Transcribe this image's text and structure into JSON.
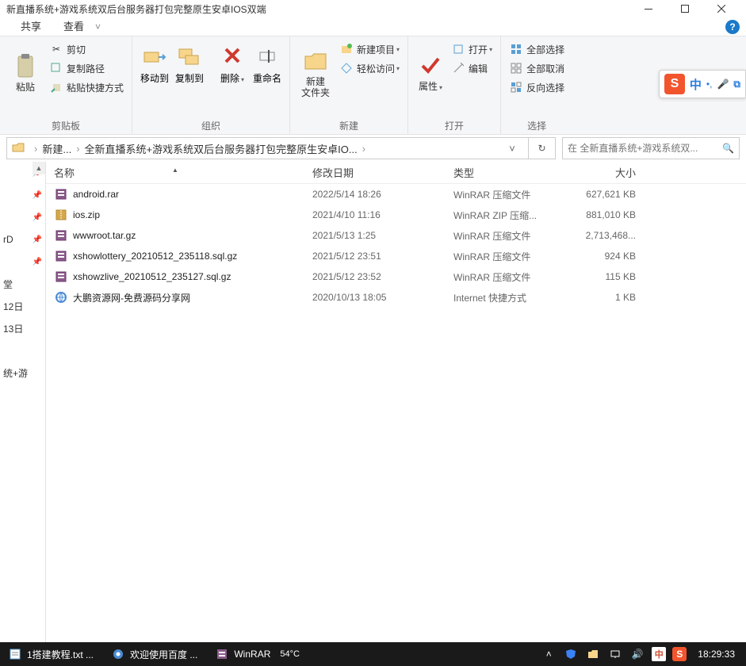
{
  "window": {
    "title_partial": "新直播系统+游戏系统双后台服务器打包完整原生安卓IOS双端"
  },
  "tabs": {
    "share": "共享",
    "view": "查看"
  },
  "help_icon": "?",
  "ribbon": {
    "clipboard": {
      "label": "剪贴板",
      "paste": "粘贴",
      "cut": "剪切",
      "copypath": "复制路径",
      "pasteshortcut": "粘贴快捷方式"
    },
    "organize": {
      "label": "组织",
      "moveto": "移动到",
      "copyto": "复制到",
      "delete": "删除",
      "rename": "重命名"
    },
    "new": {
      "label": "新建",
      "newfolder": "新建\n文件夹",
      "newitem": "新建项目",
      "easyaccess": "轻松访问"
    },
    "open": {
      "label": "打开",
      "properties": "属性",
      "open": "打开",
      "edit": "编辑"
    },
    "select": {
      "label": "选择",
      "selectall": "全部选择",
      "selectnone": "全部取消",
      "invert": "反向选择"
    }
  },
  "breadcrumb": {
    "items": [
      "新建...",
      "全新直播系统+游戏系统双后台服务器打包完整原生安卓IO..."
    ]
  },
  "search": {
    "placeholder": "在 全新直播系统+游戏系统双..."
  },
  "nav": {
    "items": [
      "",
      "",
      "",
      "rD",
      "",
      "堂",
      "12日",
      "13日",
      "",
      "统+游"
    ]
  },
  "columns": {
    "name": "名称",
    "date": "修改日期",
    "type": "类型",
    "size": "大小"
  },
  "files": [
    {
      "icon": "rar",
      "name": "android.rar",
      "date": "2022/5/14 18:26",
      "type": "WinRAR 压缩文件",
      "size": "627,621 KB"
    },
    {
      "icon": "zip",
      "name": "ios.zip",
      "date": "2021/4/10 11:16",
      "type": "WinRAR ZIP 压缩...",
      "size": "881,010 KB"
    },
    {
      "icon": "rar",
      "name": "wwwroot.tar.gz",
      "date": "2021/5/13 1:25",
      "type": "WinRAR 压缩文件",
      "size": "2,713,468..."
    },
    {
      "icon": "rar",
      "name": "xshowlottery_20210512_235118.sql.gz",
      "date": "2021/5/12 23:51",
      "type": "WinRAR 压缩文件",
      "size": "924 KB"
    },
    {
      "icon": "rar",
      "name": "xshowzlive_20210512_235127.sql.gz",
      "date": "2021/5/12 23:52",
      "type": "WinRAR 压缩文件",
      "size": "115 KB"
    },
    {
      "icon": "url",
      "name": "大鹏资源网-免费源码分享网",
      "date": "2020/10/13 18:05",
      "type": "Internet 快捷方式",
      "size": "1 KB"
    }
  ],
  "taskbar": {
    "tasks": [
      {
        "label": "1搭建教程.txt ...",
        "icon": "notepad"
      },
      {
        "label": "欢迎使用百度 ...",
        "icon": "browser"
      },
      {
        "label": "WinRAR",
        "icon": "rar"
      }
    ],
    "temp": "54°C",
    "clock": "18:29:33",
    "lang": "中"
  },
  "ime": {
    "zhong": "中",
    "s": "S"
  }
}
